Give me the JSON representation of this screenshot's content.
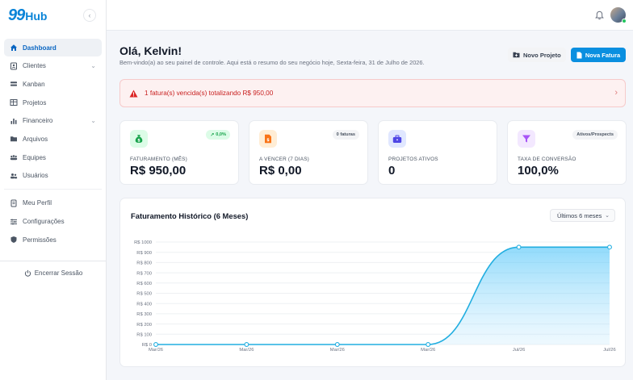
{
  "brand": {
    "num": "99",
    "hub": "Hub"
  },
  "colors": {
    "primary": "#0a8fe0",
    "danger": "#c81e1e",
    "success": "#22c55e",
    "chart_line": "#22aee0"
  },
  "sidebar": {
    "items": [
      {
        "label": "Dashboard",
        "icon": "home-icon",
        "active": true
      },
      {
        "label": "Clientes",
        "icon": "contacts-icon",
        "has_chevron": true
      },
      {
        "label": "Kanban",
        "icon": "kanban-icon"
      },
      {
        "label": "Projetos",
        "icon": "table-icon"
      },
      {
        "label": "Financeiro",
        "icon": "bar-chart-icon",
        "has_chevron": true
      },
      {
        "label": "Arquivos",
        "icon": "folder-icon"
      },
      {
        "label": "Equipes",
        "icon": "team-icon"
      },
      {
        "label": "Usuários",
        "icon": "users-icon"
      }
    ],
    "secondary": [
      {
        "label": "Meu Perfil",
        "icon": "id-card-icon"
      },
      {
        "label": "Configurações",
        "icon": "sliders-icon"
      },
      {
        "label": "Permissões",
        "icon": "shield-icon"
      }
    ],
    "logout_label": "Encerrar Sessão"
  },
  "header": {
    "greeting": "Olá, Kelvin!",
    "subtitle": "Bem-vindo(a) ao seu painel de controle. Aqui está o resumo do seu negócio hoje, Sexta-feira, 31 de Julho de 2026.",
    "new_project": "Novo Projeto",
    "new_invoice": "Nova Fatura"
  },
  "alert": {
    "text": "1 fatura(s) vencida(s) totalizando R$ 950,00"
  },
  "cards": [
    {
      "label": "FATURAMENTO (MÊS)",
      "value": "R$ 950,00",
      "badge": "0,0%",
      "badge_style": "success",
      "icon": "money-bag-icon"
    },
    {
      "label": "A VENCER (7 DIAS)",
      "value": "R$ 0,00",
      "badge": "0 faturas",
      "badge_style": "neutral",
      "icon": "invoice-icon"
    },
    {
      "label": "PROJETOS ATIVOS",
      "value": "0",
      "badge": "",
      "badge_style": "none",
      "icon": "briefcase-icon"
    },
    {
      "label": "TAXA DE CONVERSÃO",
      "value": "100,0%",
      "badge": "Ativos/Prospects",
      "badge_style": "neutral",
      "icon": "funnel-icon"
    }
  ],
  "chart_title": "Faturamento Histórico (6 Meses)",
  "chart_period": "Últimos 6 meses",
  "chart_data": {
    "type": "area",
    "title": "Faturamento Histórico (6 Meses)",
    "categories": [
      "Mar/26",
      "Mar/26",
      "Mar/26",
      "Mar/26",
      "Jul/26",
      "Jul/26"
    ],
    "series": [
      {
        "values": [
          0,
          0,
          0,
          0,
          950,
          950
        ]
      }
    ],
    "ylim": [
      0,
      1000
    ],
    "y_ticks": [
      "R$ 0",
      "R$ 100",
      "R$ 200",
      "R$ 300",
      "R$ 400",
      "R$ 500",
      "R$ 600",
      "R$ 700",
      "R$ 800",
      "R$ 900",
      "R$ 1000"
    ],
    "grid": true
  }
}
